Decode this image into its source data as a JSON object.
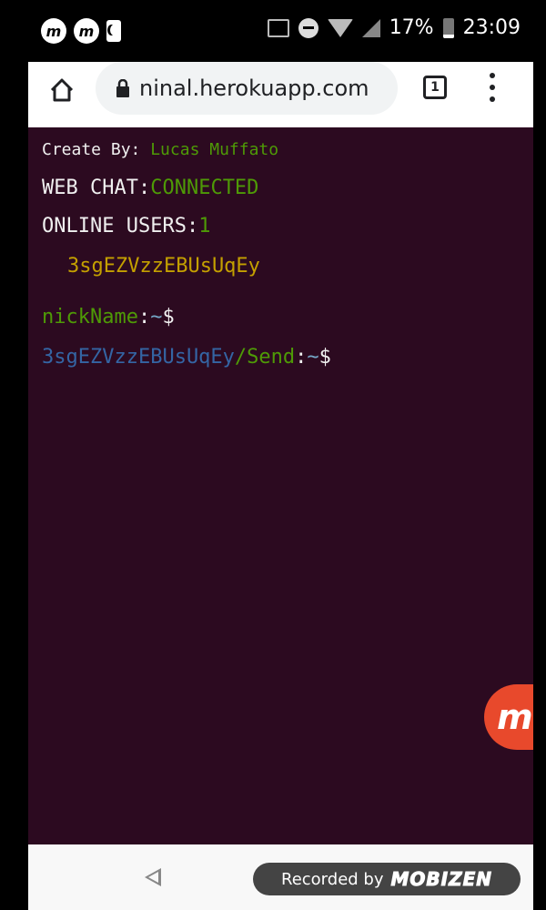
{
  "status_bar": {
    "left_badges": [
      "m",
      "m"
    ],
    "battery_percent": "17%",
    "time": "23:09"
  },
  "browser": {
    "url": "ninal.herokuapp.com",
    "tab_count": "1"
  },
  "terminal": {
    "create_label": "Create By:",
    "create_name": "Lucas Muffato",
    "webchat_label": "WEB CHAT:",
    "webchat_status": "CONNECTED",
    "online_label": "ONLINE USERS:",
    "online_count": "1",
    "users": [
      "3sgEZVzzEBUsUqEy"
    ],
    "nick_label": "nickName",
    "nick_sep": ":",
    "prompt_tilde": "~",
    "prompt_dollar": "$",
    "send_user": "3sgEZVzzEBUsUqEy",
    "send_label": "/Send",
    "send_sep": ":"
  },
  "overlay": {
    "bubble_letter": "m",
    "recorded_text": "Recorded by",
    "recorded_brand": "MOBIZEN"
  },
  "colors": {
    "terminal_bg": "#2c0a20",
    "green": "#4e9a06",
    "yellow": "#c4a000",
    "blue": "#3465a4",
    "mobizen_red": "#e8492c"
  }
}
